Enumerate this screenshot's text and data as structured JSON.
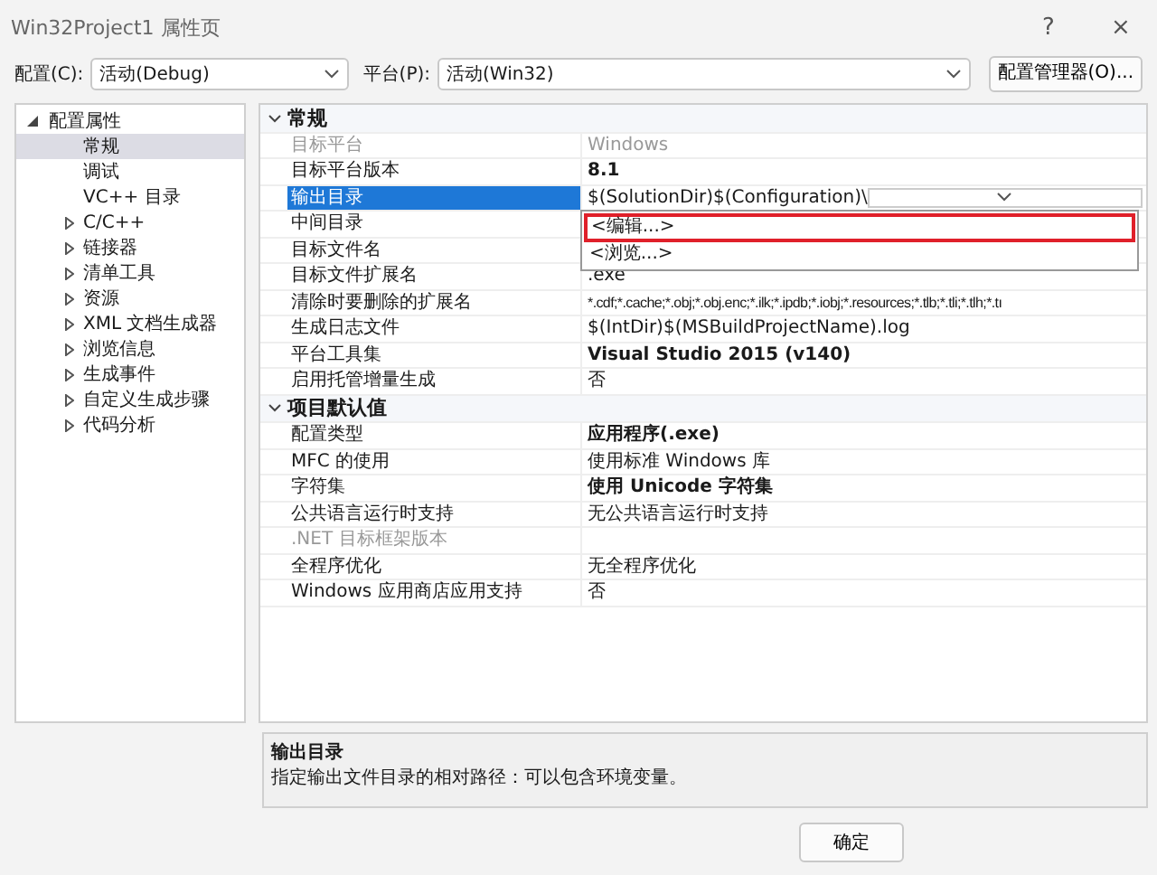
{
  "window": {
    "title": "Win32Project1 属性页",
    "help": "?",
    "close": "×"
  },
  "toolbar": {
    "config_label": "配置(C):",
    "config_value": "活动(Debug)",
    "platform_label": "平台(P):",
    "platform_value": "活动(Win32)",
    "manager_button": "配置管理器(O)..."
  },
  "tree": [
    {
      "label": "配置属性",
      "expanded": true,
      "selected": false,
      "children": [
        {
          "label": "常规",
          "selected": true,
          "expandable": false
        },
        {
          "label": "调试",
          "selected": false,
          "expandable": false
        },
        {
          "label": "VC++ 目录",
          "selected": false,
          "expandable": false
        },
        {
          "label": "C/C++",
          "selected": false,
          "expandable": true
        },
        {
          "label": "链接器",
          "selected": false,
          "expandable": true
        },
        {
          "label": "清单工具",
          "selected": false,
          "expandable": true
        },
        {
          "label": "资源",
          "selected": false,
          "expandable": true
        },
        {
          "label": "XML 文档生成器",
          "selected": false,
          "expandable": true
        },
        {
          "label": "浏览信息",
          "selected": false,
          "expandable": true
        },
        {
          "label": "生成事件",
          "selected": false,
          "expandable": true
        },
        {
          "label": "自定义生成步骤",
          "selected": false,
          "expandable": true
        },
        {
          "label": "代码分析",
          "selected": false,
          "expandable": true
        }
      ]
    }
  ],
  "grid": {
    "sections": [
      {
        "title": "常规",
        "expanded": true,
        "rows": [
          {
            "name": "目标平台",
            "value": "Windows",
            "disabled": true,
            "bold": false,
            "selected": false
          },
          {
            "name": "目标平台版本",
            "value": "8.1",
            "disabled": false,
            "bold": true,
            "selected": false
          },
          {
            "name": "输出目录",
            "value": "$(SolutionDir)$(Configuration)\\",
            "disabled": false,
            "bold": false,
            "selected": true,
            "dropdown": true
          },
          {
            "name": "中间目录",
            "disabled": false,
            "selected": false
          },
          {
            "name": "目标文件名",
            "disabled": false,
            "selected": false
          },
          {
            "name": "目标文件扩展名",
            "value": ".exe",
            "disabled": false,
            "bold": false,
            "selected": false
          },
          {
            "name": "清除时要删除的扩展名",
            "value": "*.cdf;*.cache;*.obj;*.obj.enc;*.ilk;*.ipdb;*.iobj;*.resources;*.tlb;*.tli;*.tlh;*.tı",
            "disabled": false,
            "bold": false,
            "selected": false
          },
          {
            "name": "生成日志文件",
            "value": "$(IntDir)$(MSBuildProjectName).log",
            "disabled": false,
            "bold": false,
            "selected": false
          },
          {
            "name": "平台工具集",
            "value": "Visual Studio 2015 (v140)",
            "disabled": false,
            "bold": true,
            "selected": false
          },
          {
            "name": "启用托管增量生成",
            "value": "否",
            "disabled": false,
            "bold": false,
            "selected": false
          }
        ]
      },
      {
        "title": "项目默认值",
        "expanded": true,
        "rows": [
          {
            "name": "配置类型",
            "value": "应用程序(.exe)",
            "disabled": false,
            "bold": true,
            "selected": false
          },
          {
            "name": "MFC 的使用",
            "value": "使用标准 Windows 库",
            "disabled": false,
            "bold": false,
            "selected": false
          },
          {
            "name": "字符集",
            "value": "使用 Unicode 字符集",
            "disabled": false,
            "bold": true,
            "selected": false
          },
          {
            "name": "公共语言运行时支持",
            "value": "无公共语言运行时支持",
            "disabled": false,
            "bold": false,
            "selected": false
          },
          {
            "name": ".NET 目标框架版本",
            "disabled": true,
            "selected": false
          },
          {
            "name": "全程序优化",
            "value": "无全程序优化",
            "disabled": false,
            "bold": false,
            "selected": false
          },
          {
            "name": "Windows 应用商店应用支持",
            "value": "否",
            "disabled": false,
            "bold": false,
            "selected": false
          }
        ]
      }
    ],
    "dropdown_options": [
      {
        "label": "<编辑...>",
        "selected": true
      },
      {
        "label": "<浏览...>",
        "selected": false
      }
    ]
  },
  "description": {
    "title": "输出目录",
    "text": "指定输出文件目录的相对路径：可以包含环境变量。"
  },
  "buttons": [
    "确定"
  ]
}
